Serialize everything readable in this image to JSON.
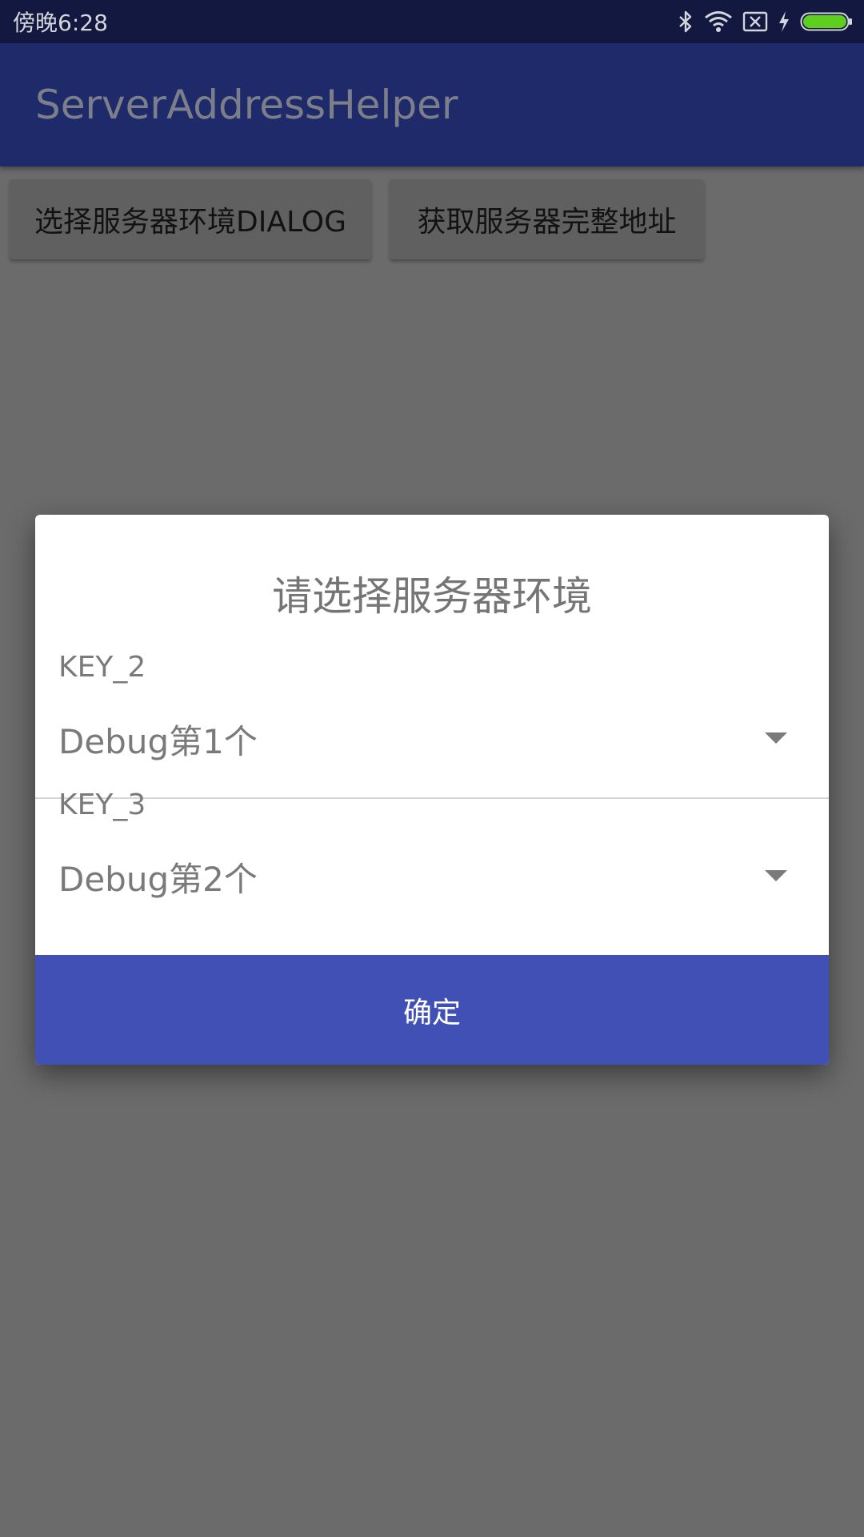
{
  "status_bar": {
    "time": "傍晚6:28",
    "icons": [
      "bluetooth-icon",
      "wifi-icon",
      "sim-card-x-icon",
      "charging-bolt-icon",
      "battery-icon"
    ],
    "battery_color": "#5ecf1e"
  },
  "app_bar": {
    "title": "ServerAddressHelper",
    "background_color": "#1f2a6b"
  },
  "main": {
    "select_env_dialog_button": "选择服务器环境DIALOG",
    "get_full_address_button": "获取服务器完整地址"
  },
  "dialog": {
    "title": "请选择服务器环境",
    "fields": [
      {
        "key": "KEY_2",
        "value": "Debug第1个"
      },
      {
        "key": "KEY_3",
        "value": "Debug第2个"
      }
    ],
    "confirm_label": "确定",
    "confirm_color": "#4050b5"
  }
}
